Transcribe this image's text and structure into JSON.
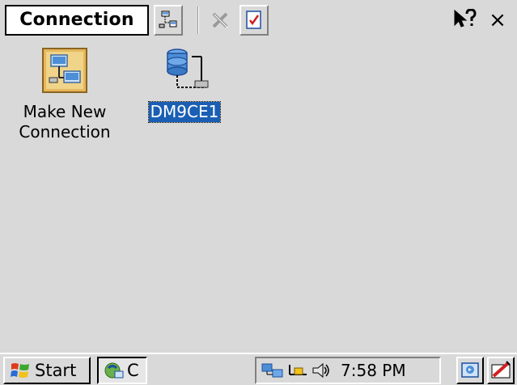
{
  "command_bar": {
    "title": "Connection",
    "buttons": [
      {
        "name": "connect-icon"
      },
      {
        "name": "delete-icon",
        "disabled": true
      },
      {
        "name": "properties-icon"
      }
    ],
    "help_icon": "help-icon",
    "close_label": "×"
  },
  "desktop": {
    "items": [
      {
        "label_line1": "Make New",
        "label_line2": "Connection",
        "icon": "make-new-connection-icon"
      },
      {
        "label": "DM9CE1",
        "icon": "network-connection-icon",
        "selected": true
      }
    ]
  },
  "taskbar": {
    "start_label": "Start",
    "task_label": "C",
    "tray_icons": [
      "network-status-icon",
      "ethernet-icon",
      "volume-icon"
    ],
    "clock": "7:58 PM",
    "desktop_button_icon": "show-desktop-icon",
    "input_panel_icon": "input-panel-icon"
  },
  "colors": {
    "background": "#d9d9d9",
    "selection": "#1a5fb4"
  }
}
